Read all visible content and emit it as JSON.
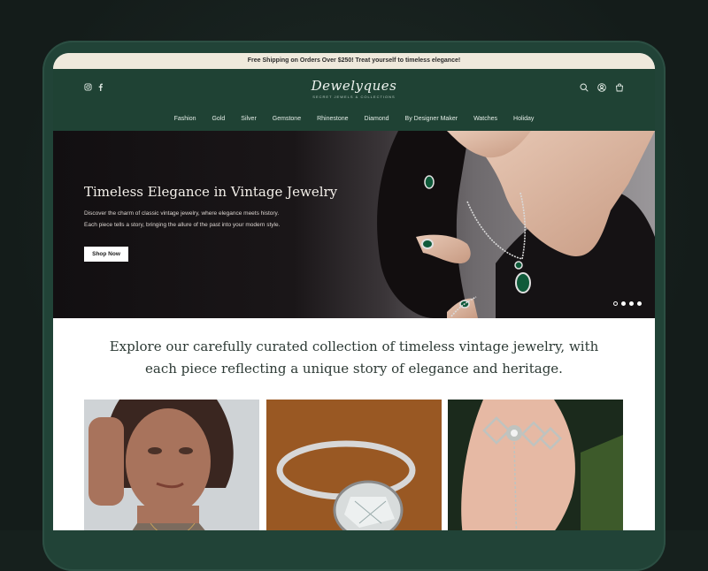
{
  "announcement": "Free Shipping on Orders Over $250! Treat yourself to timeless elegance!",
  "brand": {
    "name": "Dewelyques",
    "tagline": "SECRET JEWELS & COLLECTIONS"
  },
  "nav": [
    "Fashion",
    "Gold",
    "Silver",
    "Gemstone",
    "Rhinestone",
    "Diamond",
    "By Designer Maker",
    "Watches",
    "Holiday"
  ],
  "social_icons": [
    "instagram-icon",
    "facebook-icon"
  ],
  "utility_icons": [
    "search-icon",
    "account-icon",
    "cart-icon"
  ],
  "hero": {
    "title": "Timeless Elegance in Vintage Jewelry",
    "text": "Discover the charm of classic vintage jewelry, where elegance meets history. Each piece tells a story, bringing the allure of the past into your modern style.",
    "cta": "Shop Now",
    "slides_count": 4,
    "active_slide": 1
  },
  "intro": "Explore our carefully curated collection of timeless vintage jewelry, with each piece reflecting a unique story of elegance and heritage.",
  "colors": {
    "brand_green": "#1f4234",
    "announce_bg": "#efe9dc"
  }
}
